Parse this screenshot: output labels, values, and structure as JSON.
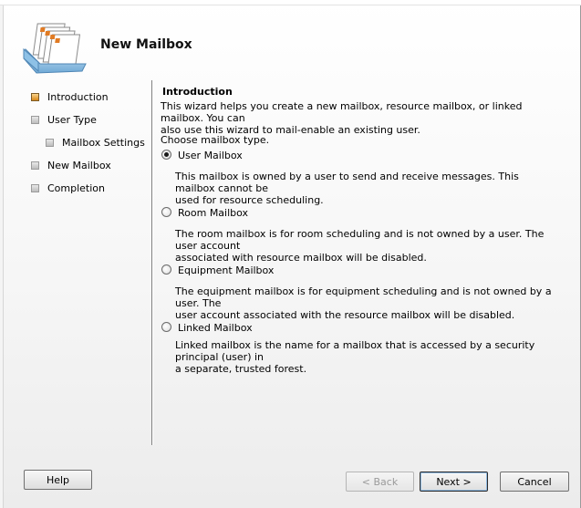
{
  "wizard": {
    "title": "New Mailbox"
  },
  "nav": [
    {
      "label": "Introduction",
      "state": "active"
    },
    {
      "label": "User Type",
      "state": "pending"
    },
    {
      "label": "Mailbox Settings",
      "state": "pending"
    },
    {
      "label": "New Mailbox",
      "state": "pending"
    },
    {
      "label": "Completion",
      "state": "pending"
    }
  ],
  "content": {
    "heading": "Introduction",
    "intro_line1": "This wizard helps you create a new mailbox, resource mailbox, or linked mailbox. You can",
    "intro_line2": "also use this wizard to mail-enable an existing user.",
    "choose_label": "Choose mailbox type.",
    "options": [
      {
        "label": "User Mailbox",
        "checked": true,
        "desc_line1": "This mailbox is owned by a user to send and receive messages. This mailbox cannot be",
        "desc_line2": "used for resource scheduling."
      },
      {
        "label": "Room Mailbox",
        "checked": false,
        "desc_line1": "The room mailbox is for room scheduling and is not owned by a user. The user account",
        "desc_line2": "associated with resource mailbox will be disabled."
      },
      {
        "label": "Equipment Mailbox",
        "checked": false,
        "desc_line1": "The equipment mailbox is for equipment scheduling and is not owned by a user. The",
        "desc_line2": "user account associated with the resource mailbox will be disabled."
      },
      {
        "label": "Linked Mailbox",
        "checked": false,
        "desc_line1": "Linked mailbox is the name for a mailbox that is accessed by a security principal (user) in",
        "desc_line2": "a separate, trusted forest."
      }
    ]
  },
  "buttons": {
    "help": "Help",
    "back": "< Back",
    "next": "Next >",
    "cancel": "Cancel"
  },
  "colors": {
    "active_step": "#e0901f",
    "window_bg": "#f4f4f4"
  }
}
